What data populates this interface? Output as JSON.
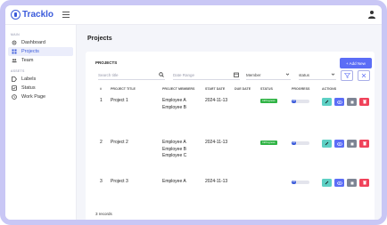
{
  "app": {
    "name": "Tracklo"
  },
  "sidebar": {
    "sections": [
      {
        "title": "MAIN",
        "items": [
          {
            "label": "Dashboard",
            "icon": "gear-icon",
            "active": false
          },
          {
            "label": "Projects",
            "icon": "grid-icon",
            "active": true
          },
          {
            "label": "Team",
            "icon": "team-icon",
            "active": false
          }
        ]
      },
      {
        "title": "ASSETS",
        "items": [
          {
            "label": "Labels",
            "icon": "label-icon",
            "active": false
          },
          {
            "label": "Status",
            "icon": "status-icon",
            "active": false
          },
          {
            "label": "Work Page",
            "icon": "clock-icon",
            "active": false
          }
        ]
      }
    ]
  },
  "page": {
    "title": "Projects"
  },
  "projects_card": {
    "title": "PROJECTS",
    "add_button": "+ Add New",
    "filters": {
      "search_placeholder": "Search title",
      "date_placeholder": "Date Range",
      "member_value": "Member",
      "status_value": "status"
    },
    "columns": [
      "#",
      "PROJECT TITLE",
      "PROJECT MEMBERS",
      "START DATE",
      "DUE DATE",
      "STATUS",
      "PROGRESS",
      "ACTIONS"
    ],
    "rows": [
      {
        "num": "1",
        "title": "Project 1",
        "members": [
          "Employee A",
          "Employee B"
        ],
        "start": "2024-11-13",
        "due": "",
        "status": "InProgress",
        "progress": "25",
        "progress_value": 0.25
      },
      {
        "num": "2",
        "title": "Project 2",
        "members": [
          "Employee A",
          "Employee B",
          "Employee C"
        ],
        "start": "2024-11-13",
        "due": "",
        "status": "InProgress",
        "progress": "25",
        "progress_value": 0.25
      },
      {
        "num": "3",
        "title": "Project 3",
        "members": [
          "Employee A"
        ],
        "start": "2024-11-13",
        "due": "",
        "status": "",
        "progress": "25",
        "progress_value": 0.25
      }
    ],
    "records": "3 records"
  },
  "colors": {
    "accent": "#3b5bdb",
    "add_button": "#5b6df6",
    "status_inprogress": "#2fb344",
    "action_edit": "#5dd0c4",
    "action_view": "#5b6df6",
    "action_mute": "#7d8594",
    "action_delete": "#f0425a",
    "frame": "#c9c7f5"
  }
}
